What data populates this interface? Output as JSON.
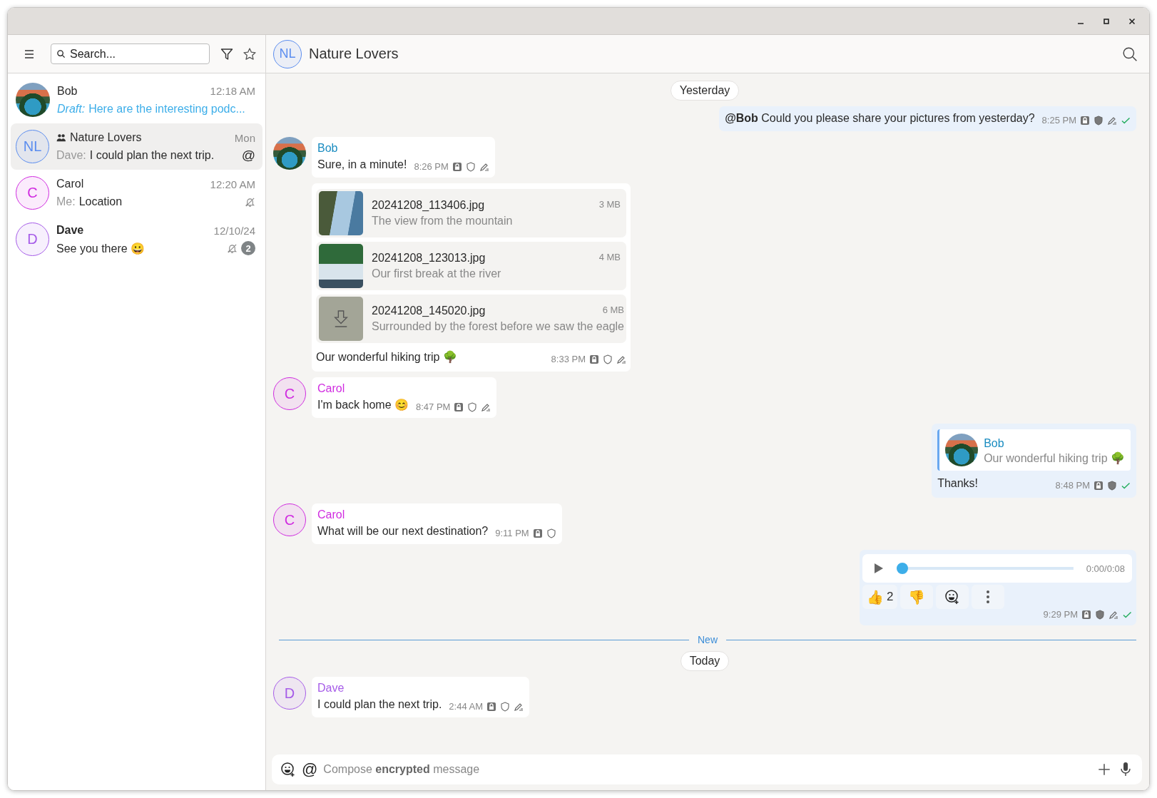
{
  "sidebar": {
    "search": {
      "placeholder": "Search..."
    },
    "chats": [
      {
        "name": "Bob",
        "photo": true,
        "color": "#3aa0c8",
        "group": false,
        "time": "12:18 AM",
        "draft": true,
        "prefix": "Draft:",
        "preview": "Here are the interesting podc...",
        "selected": false,
        "unread": false,
        "muted": false
      },
      {
        "name": "Nature Lovers",
        "photo": false,
        "initials": "NL",
        "color": "#5b8def",
        "group": true,
        "time": "Mon",
        "draft": false,
        "prefix": "Dave:",
        "preview": "I could plan the next trip.",
        "mention_mark": "@",
        "selected": true,
        "unread": false,
        "muted": false
      },
      {
        "name": "Carol",
        "photo": false,
        "initials": "C",
        "color": "#d02ce0",
        "group": false,
        "time": "12:20 AM",
        "draft": false,
        "prefix": "Me:",
        "preview": "Location",
        "selected": false,
        "unread": false,
        "muted": true
      },
      {
        "name": "Dave",
        "photo": false,
        "initials": "D",
        "color": "#a65ce8",
        "group": false,
        "time": "12/10/24",
        "draft": false,
        "preview": "See you there 😀",
        "unread_count": "2",
        "selected": false,
        "unread": true,
        "muted": true
      }
    ]
  },
  "conversation": {
    "initials": "NL",
    "color": "#5b8def",
    "title": "Nature Lovers"
  },
  "messages": [
    {
      "kind": "date",
      "text": "Yesterday"
    },
    {
      "kind": "outgoing",
      "text": "**@Bob** Could you please share your pictures from yesterday?",
      "time": "8:25 PM",
      "verified": true,
      "edited": true,
      "delivered": true
    },
    {
      "kind": "incoming",
      "sender": "Bob",
      "photo": true,
      "color": "#1a8cc0",
      "text": "Sure, in a minute!",
      "time": "8:26 PM",
      "verified": false,
      "edited": true
    },
    {
      "kind": "files",
      "files": [
        {
          "name": "20241208_113406.jpg",
          "size": "3 MB",
          "caption": "The view from the mountain",
          "downloaded": true
        },
        {
          "name": "20241208_123013.jpg",
          "size": "4 MB",
          "caption": "Our first break at the river",
          "downloaded": true
        },
        {
          "name": "20241208_145020.jpg",
          "size": "6 MB",
          "caption": "Surrounded by the forest before we saw the eagle",
          "downloaded": false
        }
      ],
      "text": "Our wonderful hiking trip 🌳",
      "time": "8:33 PM",
      "verified": false,
      "edited": true
    },
    {
      "kind": "incoming",
      "sender": "Carol",
      "photo": false,
      "initials": "C",
      "color": "#d02ce0",
      "text": "I'm back home 😊",
      "time": "8:47 PM",
      "verified": false,
      "edited": true
    },
    {
      "kind": "reply",
      "quote": {
        "sender": "Bob",
        "text": "Our wonderful hiking trip 🌳"
      },
      "text": "Thanks!",
      "time": "8:48 PM",
      "verified": true,
      "edited": false,
      "delivered": true
    },
    {
      "kind": "incoming",
      "sender": "Carol",
      "photo": false,
      "initials": "C",
      "color": "#d02ce0",
      "text": "What will be our next destination?",
      "time": "9:11 PM",
      "verified": false,
      "edited": false
    },
    {
      "kind": "audio",
      "duration": "0:00/0:08",
      "level": 0,
      "reactions": [
        {
          "emoji": "👍",
          "count": "2"
        },
        {
          "emoji": "👎"
        }
      ],
      "time": "9:29 PM",
      "verified": true,
      "edited": true,
      "delivered": true
    },
    {
      "kind": "divider",
      "text": "New"
    },
    {
      "kind": "date",
      "text": "Today"
    },
    {
      "kind": "incoming",
      "sender": "Dave",
      "photo": false,
      "initials": "D",
      "color": "#a65ce8",
      "text": "I could plan the next trip.",
      "time": "2:44 AM",
      "verified": false,
      "edited": true
    }
  ],
  "composer": {
    "mention_mark": "@",
    "placeholder": "Compose **encrypted** message"
  }
}
